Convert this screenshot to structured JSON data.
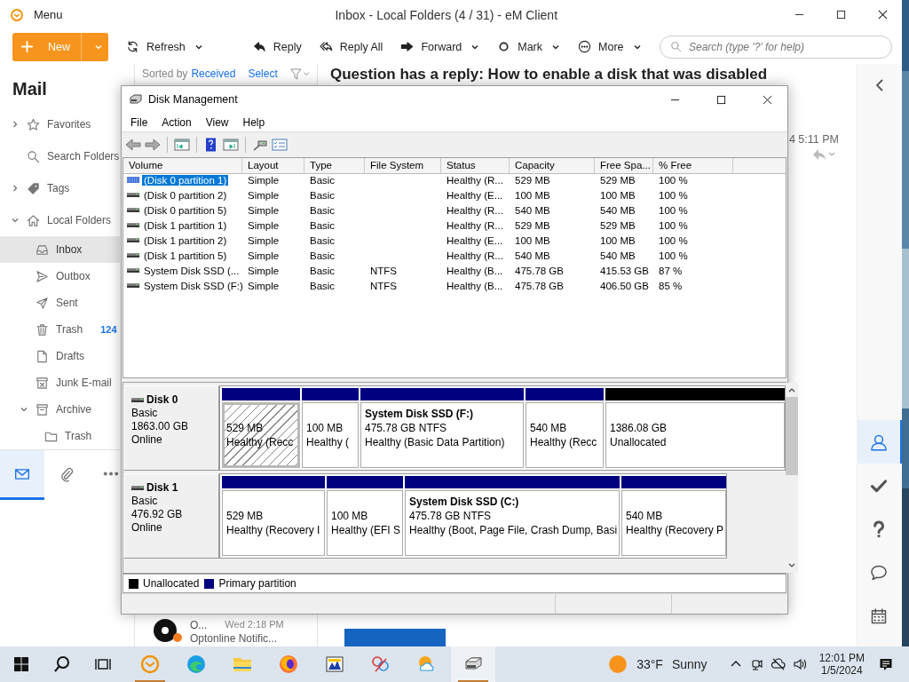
{
  "em_client": {
    "title": "Inbox - Local Folders (4 / 31) - eM Client",
    "menu_label": "Menu",
    "toolbar": [
      {
        "kind": "new",
        "label": "New",
        "dropdown": true
      },
      {
        "kind": "refresh",
        "label": "Refresh",
        "dropdown": true
      },
      {
        "kind": "reply",
        "label": "Reply",
        "dropdown": false
      },
      {
        "kind": "reply_all",
        "label": "Reply All",
        "dropdown": false
      },
      {
        "kind": "forward",
        "label": "Forward",
        "dropdown": true
      },
      {
        "kind": "mark",
        "label": "Mark",
        "dropdown": true
      },
      {
        "kind": "more",
        "label": "More",
        "dropdown": true
      }
    ],
    "search": {
      "placeholder": "Search (type '?' for help)"
    },
    "sidebar": {
      "heading": "Mail",
      "items": [
        {
          "label": "Favorites",
          "kind": "star",
          "expanded": false,
          "selected": false
        },
        {
          "label": "Search Folders",
          "kind": "search",
          "selected": false
        },
        {
          "label": "Tags",
          "kind": "tag",
          "expanded": false,
          "selected": false
        },
        {
          "label": "Local Folders",
          "kind": "home",
          "expanded": true,
          "selected": false,
          "children": [
            {
              "label": "Inbox",
              "kind": "inbox",
              "selected": true
            },
            {
              "label": "Outbox",
              "kind": "outbox",
              "selected": false
            },
            {
              "label": "Sent",
              "kind": "sent",
              "selected": false
            },
            {
              "label": "Trash",
              "kind": "trash",
              "selected": false,
              "count": "124"
            },
            {
              "label": "Drafts",
              "kind": "draft",
              "selected": false
            },
            {
              "label": "Junk E-mail",
              "kind": "junk",
              "selected": false
            },
            {
              "label": "Archive",
              "kind": "archive",
              "expanded": true,
              "selected": false,
              "children": [
                {
                  "label": "Trash",
                  "kind": "folder",
                  "selected": false
                }
              ]
            }
          ]
        }
      ]
    },
    "bottom_nav": [
      {
        "kind": "mail",
        "selected": true
      },
      {
        "kind": "attachment",
        "selected": false
      },
      {
        "kind": "dots",
        "selected": false
      }
    ],
    "message_list": {
      "sort_label": "Sorted by",
      "sort_field": "Received",
      "select_label": "Select",
      "messages": [
        {
          "sender": "O...",
          "time": "Wed 2:18 PM",
          "preview": "Optonline Notific..."
        }
      ]
    },
    "reading_pane": {
      "headline": "Question has a reply: How to enable a disk that was disabled",
      "date": "4 5:11 PM"
    },
    "right_rail": [
      {
        "kind": "contacts",
        "selected": true
      },
      {
        "kind": "tasks",
        "selected": false
      },
      {
        "kind": "help",
        "selected": false
      },
      {
        "kind": "chat",
        "selected": false
      },
      {
        "kind": "calendar",
        "selected": false
      }
    ]
  },
  "disk_management": {
    "title": "Disk Management",
    "menu": [
      "File",
      "Action",
      "View",
      "Help"
    ],
    "columns": [
      "Volume",
      "Layout",
      "Type",
      "File System",
      "Status",
      "Capacity",
      "Free Spa...",
      "% Free"
    ],
    "rows": [
      {
        "selected": true,
        "cells": [
          "(Disk 0 partition 1)",
          "Simple",
          "Basic",
          "",
          "Healthy (R...",
          "529 MB",
          "529 MB",
          "100 %"
        ]
      },
      {
        "selected": false,
        "cells": [
          "(Disk 0 partition 2)",
          "Simple",
          "Basic",
          "",
          "Healthy (E...",
          "100 MB",
          "100 MB",
          "100 %"
        ]
      },
      {
        "selected": false,
        "cells": [
          "(Disk 0 partition 5)",
          "Simple",
          "Basic",
          "",
          "Healthy (R...",
          "540 MB",
          "540 MB",
          "100 %"
        ]
      },
      {
        "selected": false,
        "cells": [
          "(Disk 1 partition 1)",
          "Simple",
          "Basic",
          "",
          "Healthy (R...",
          "529 MB",
          "529 MB",
          "100 %"
        ]
      },
      {
        "selected": false,
        "cells": [
          "(Disk 1 partition 2)",
          "Simple",
          "Basic",
          "",
          "Healthy (E...",
          "100 MB",
          "100 MB",
          "100 %"
        ]
      },
      {
        "selected": false,
        "cells": [
          "(Disk 1 partition 5)",
          "Simple",
          "Basic",
          "",
          "Healthy (R...",
          "540 MB",
          "540 MB",
          "100 %"
        ]
      },
      {
        "selected": false,
        "cells": [
          "System Disk SSD (...",
          "Simple",
          "Basic",
          "NTFS",
          "Healthy (B...",
          "475.78 GB",
          "415.53 GB",
          "87 %"
        ]
      },
      {
        "selected": false,
        "cells": [
          "System Disk SSD (F:)",
          "Simple",
          "Basic",
          "NTFS",
          "Healthy (B...",
          "475.78 GB",
          "406.50 GB",
          "85 %"
        ]
      }
    ],
    "disks": [
      {
        "name": "Disk 0",
        "type": "Basic",
        "size": "1863.00 GB",
        "status": "Online",
        "partitions": [
          {
            "kind": "primary",
            "selected": true,
            "lines": [
              "529 MB",
              "Healthy (Recc"
            ]
          },
          {
            "kind": "primary",
            "selected": false,
            "lines": [
              "100 MB",
              "Healthy ("
            ]
          },
          {
            "kind": "primary",
            "selected": false,
            "title": "System Disk SSD  (F:)",
            "lines": [
              "475.78 GB NTFS",
              "Healthy (Basic Data Partition)"
            ]
          },
          {
            "kind": "primary",
            "selected": false,
            "lines": [
              "540 MB",
              "Healthy (Recc"
            ]
          },
          {
            "kind": "unallocated",
            "selected": false,
            "lines": [
              "1386.08 GB",
              "Unallocated"
            ]
          }
        ]
      },
      {
        "name": "Disk 1",
        "type": "Basic",
        "size": "476.92 GB",
        "status": "Online",
        "partitions": [
          {
            "kind": "primary",
            "selected": false,
            "lines": [
              "529 MB",
              "Healthy (Recovery I"
            ]
          },
          {
            "kind": "primary",
            "selected": false,
            "lines": [
              "100 MB",
              "Healthy (EFI S"
            ]
          },
          {
            "kind": "primary",
            "selected": false,
            "title": "System Disk SSD  (C:)",
            "lines": [
              "475.78 GB NTFS",
              "Healthy (Boot, Page File, Crash Dump, Basi"
            ]
          },
          {
            "kind": "primary",
            "selected": false,
            "lines": [
              "540 MB",
              "Healthy (Recovery P"
            ]
          }
        ]
      }
    ],
    "legend": [
      {
        "label": "Unallocated",
        "color": "#000000"
      },
      {
        "label": "Primary partition",
        "color": "#000080"
      }
    ]
  },
  "taskbar": {
    "apps": [
      {
        "kind": "mail",
        "running": true,
        "selected": false
      },
      {
        "kind": "edge",
        "running": false,
        "selected": false
      },
      {
        "kind": "explorer",
        "running": false,
        "selected": false
      },
      {
        "kind": "firefox",
        "running": false,
        "selected": false
      },
      {
        "kind": "calc",
        "running": false,
        "selected": false
      },
      {
        "kind": "paint",
        "running": false,
        "selected": false
      },
      {
        "kind": "weather",
        "running": false,
        "selected": false
      },
      {
        "kind": "disk",
        "running": true,
        "selected": true
      }
    ],
    "weather": {
      "temp": "33°F",
      "condition": "Sunny"
    },
    "clock": {
      "time": "12:01 PM",
      "date": "1/5/2024"
    }
  }
}
